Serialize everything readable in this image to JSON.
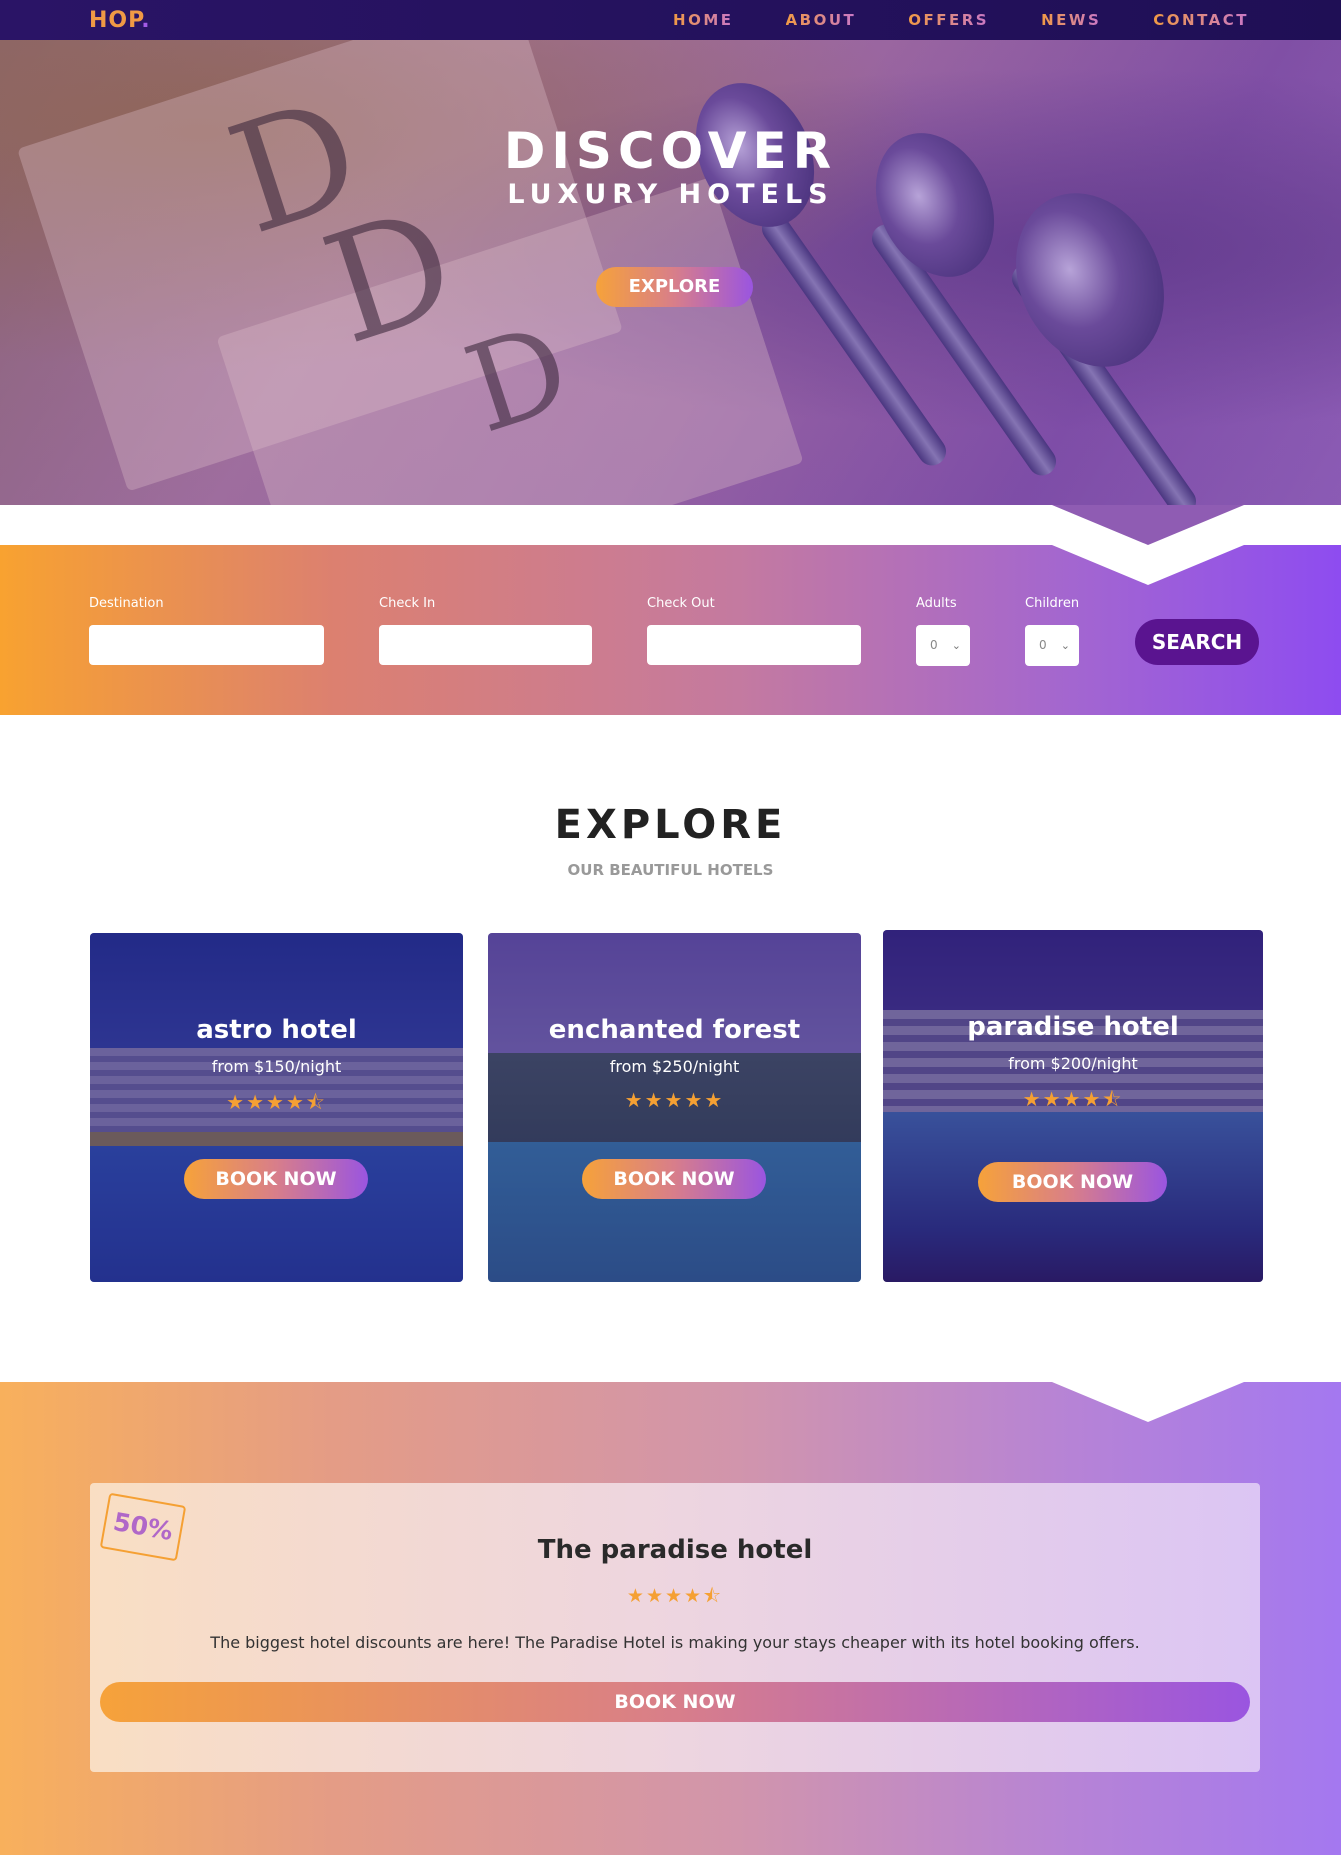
{
  "nav": {
    "logo_text": "HOP",
    "logo_dot": ".",
    "links": [
      "HOME",
      "ABOUT",
      "OFFERS",
      "NEWS",
      "CONTACT"
    ]
  },
  "hero": {
    "title": "DISCOVER",
    "subtitle": "LUXURY HOTELS",
    "button": "EXPLORE"
  },
  "search": {
    "destination_label": "Destination",
    "checkin_label": "Check In",
    "checkout_label": "Check Out",
    "adults_label": "Adults",
    "adults_value": "0",
    "children_label": "Children",
    "children_value": "0",
    "button": "SEARCH"
  },
  "explore": {
    "title": "EXPLORE",
    "subtitle": "OUR BEAUTIFUL HOTELS"
  },
  "hotels": [
    {
      "name": "astro hotel",
      "price": "from $150/night",
      "rating": 4.5,
      "stars": "★★★★⯪",
      "button": "BOOK NOW"
    },
    {
      "name": "enchanted forest",
      "price": "from $250/night",
      "rating": 5,
      "stars": "★★★★★",
      "button": "BOOK NOW"
    },
    {
      "name": "paradise hotel",
      "price": "from $200/night",
      "rating": 4.5,
      "stars": "★★★★⯪",
      "button": "BOOK NOW"
    }
  ],
  "offer": {
    "badge": "50%",
    "title": "The paradise hotel",
    "rating": 4.5,
    "stars": "★★★★⯪",
    "text": "The biggest hotel discounts are here! The Paradise Hotel is making your stays cheaper with its hotel booking offers.",
    "button": "BOOK NOW"
  },
  "colors": {
    "accent_orange": "#f6a23a",
    "accent_purple": "#9a55e0",
    "nav_bg": "#2a1466",
    "search_button": "#5a1490"
  },
  "icons": {
    "select_chevron": "chevron-down-icon",
    "star": "star-icon"
  }
}
